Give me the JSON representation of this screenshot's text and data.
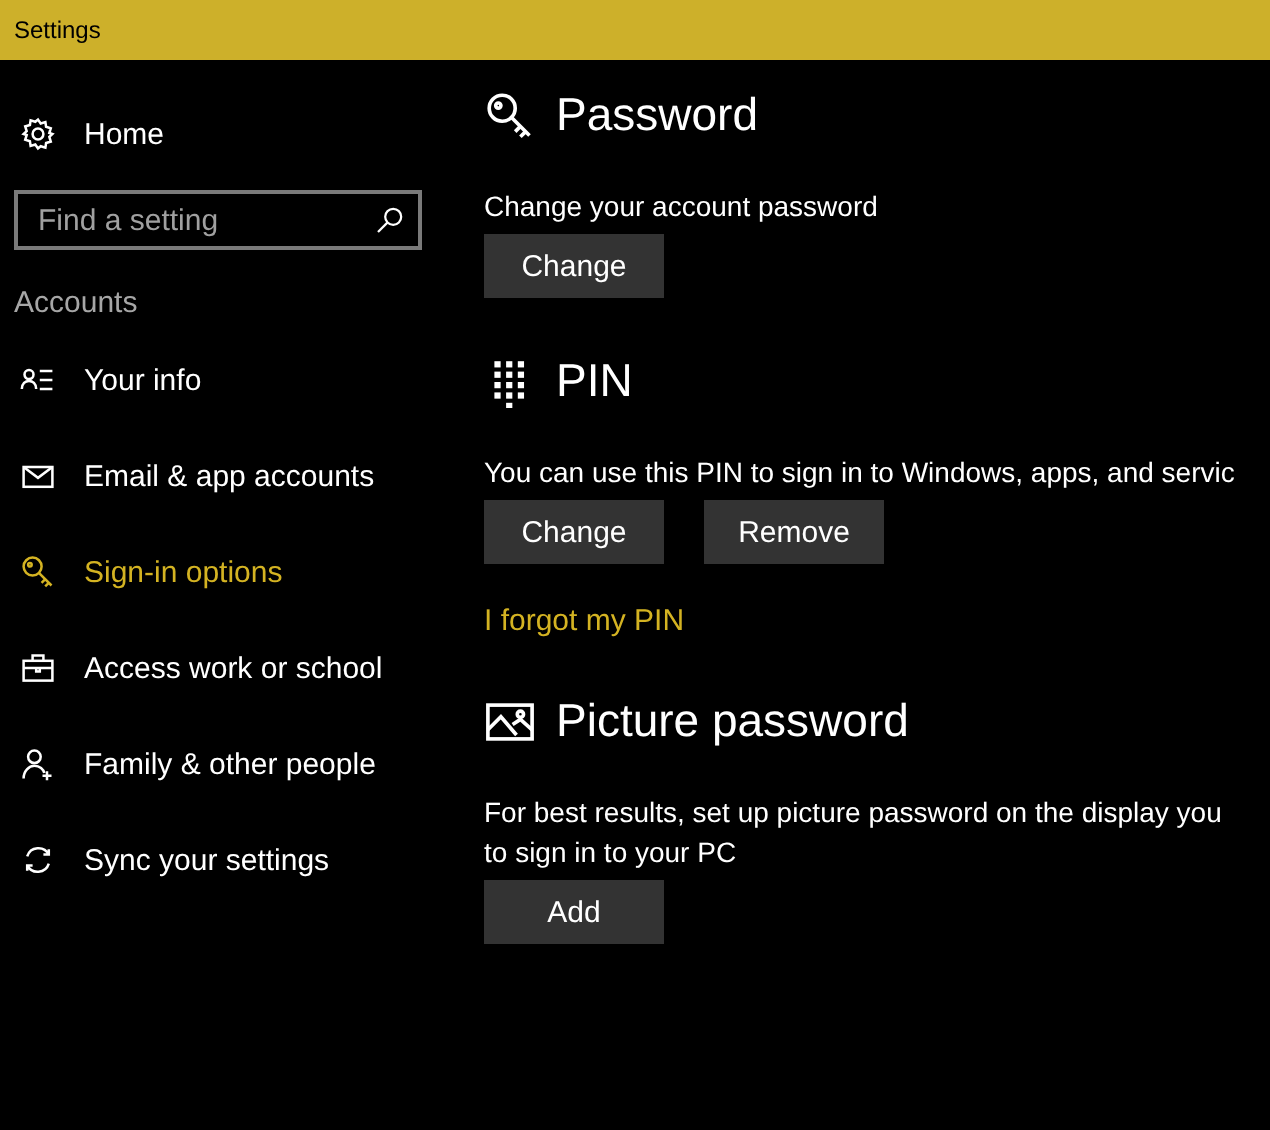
{
  "window": {
    "title": "Settings"
  },
  "sidebar": {
    "home": {
      "label": "Home"
    },
    "search": {
      "placeholder": "Find a setting"
    },
    "group": "Accounts",
    "items": [
      {
        "label": "Your info",
        "selected": false
      },
      {
        "label": "Email & app accounts",
        "selected": false
      },
      {
        "label": "Sign-in options",
        "selected": true
      },
      {
        "label": "Access work or school",
        "selected": false
      },
      {
        "label": "Family & other people",
        "selected": false
      },
      {
        "label": "Sync your settings",
        "selected": false
      }
    ]
  },
  "sections": [
    {
      "title": "Password",
      "lines": [
        "Change your account password"
      ],
      "buttons": [
        "Change"
      ]
    },
    {
      "title": "PIN",
      "lines": [
        "You can use this PIN to sign in to Windows, apps, and servic"
      ],
      "buttons": [
        "Change",
        "Remove"
      ],
      "link": "I forgot my PIN"
    },
    {
      "title": "Picture password",
      "lines": [
        "For best results, set up picture password on the display you",
        "to sign in to your PC"
      ],
      "buttons": [
        "Add"
      ]
    }
  ]
}
